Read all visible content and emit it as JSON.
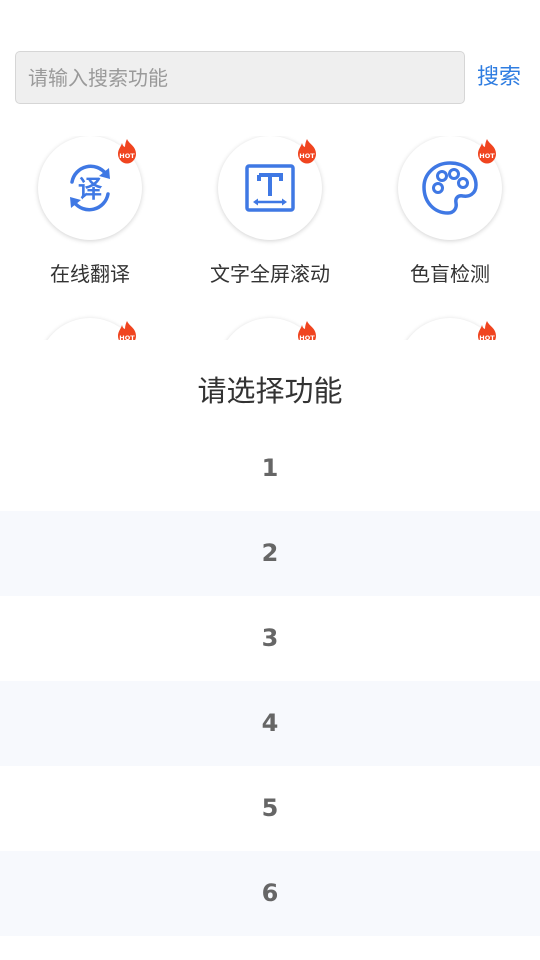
{
  "search": {
    "placeholder": "请输入搜索功能",
    "value": "",
    "button_label": "搜索"
  },
  "features": [
    {
      "label": "在线翻译",
      "icon": "translate-icon",
      "badge": "HOT"
    },
    {
      "label": "文字全屏滚动",
      "icon": "text-scroll-icon",
      "badge": "HOT"
    },
    {
      "label": "色盲检测",
      "icon": "palette-icon",
      "badge": "HOT"
    },
    {
      "label": "",
      "icon": "",
      "badge": "HOT"
    },
    {
      "label": "",
      "icon": "",
      "badge": "HOT"
    },
    {
      "label": "",
      "icon": "",
      "badge": "HOT"
    }
  ],
  "picker": {
    "title": "请选择功能",
    "options": [
      "1",
      "2",
      "3",
      "4",
      "5",
      "6"
    ]
  },
  "colors": {
    "accent": "#2f7de1",
    "icon_blue": "#3f78e4",
    "hot_red": "#f0441f"
  }
}
